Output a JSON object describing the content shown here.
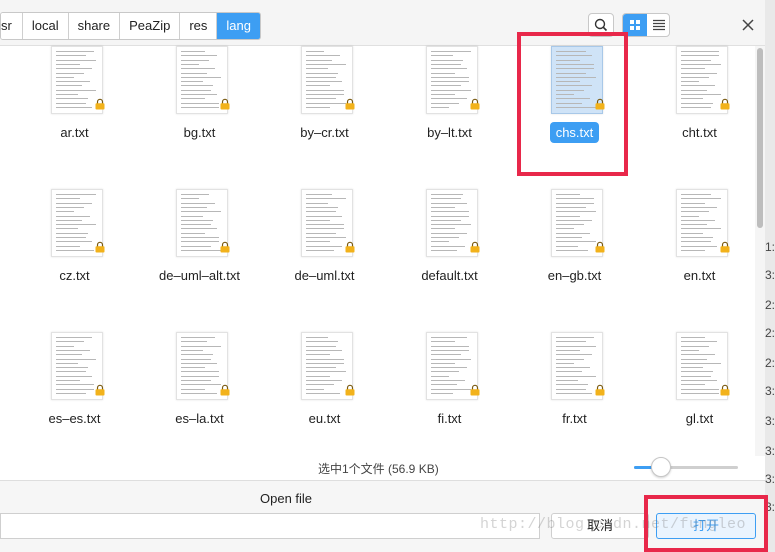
{
  "breadcrumbs": [
    {
      "label": "sr",
      "active": false
    },
    {
      "label": "local",
      "active": false
    },
    {
      "label": "share",
      "active": false
    },
    {
      "label": "PeaZip",
      "active": false
    },
    {
      "label": "res",
      "active": false
    },
    {
      "label": "lang",
      "active": true
    }
  ],
  "toolbar": {
    "search_icon": "search-icon",
    "grid_icon": "grid-view-icon",
    "list_icon": "list-view-icon",
    "close_icon": "close-icon"
  },
  "files": [
    {
      "name": "ar.txt",
      "selected": false
    },
    {
      "name": "bg.txt",
      "selected": false
    },
    {
      "name": "by–cr.txt",
      "selected": false
    },
    {
      "name": "by–lt.txt",
      "selected": false
    },
    {
      "name": "chs.txt",
      "selected": true
    },
    {
      "name": "cht.txt",
      "selected": false
    },
    {
      "name": "cz.txt",
      "selected": false
    },
    {
      "name": "de–uml–alt.txt",
      "selected": false
    },
    {
      "name": "de–uml.txt",
      "selected": false
    },
    {
      "name": "default.txt",
      "selected": false
    },
    {
      "name": "en–gb.txt",
      "selected": false
    },
    {
      "name": "en.txt",
      "selected": false
    },
    {
      "name": "es–es.txt",
      "selected": false
    },
    {
      "name": "es–la.txt",
      "selected": false
    },
    {
      "name": "eu.txt",
      "selected": false
    },
    {
      "name": "fi.txt",
      "selected": false
    },
    {
      "name": "fr.txt",
      "selected": false
    },
    {
      "name": "gl.txt",
      "selected": false
    }
  ],
  "status": {
    "text": "选中1个文件 (56.9 KB)",
    "zoom_fraction": 0.26
  },
  "footer": {
    "title": "Open file",
    "cancel_label": "取消",
    "open_label": "打开"
  },
  "watermark": "http://blog.csdn.net/fungleo",
  "backdrop_ticks": [
    "1:",
    "3:",
    "2:",
    "2:",
    "2:",
    "3:",
    "3:",
    "3:",
    "3:",
    "3:"
  ],
  "colors": {
    "accent": "#3d9ef3",
    "highlight": "#e8284a"
  }
}
